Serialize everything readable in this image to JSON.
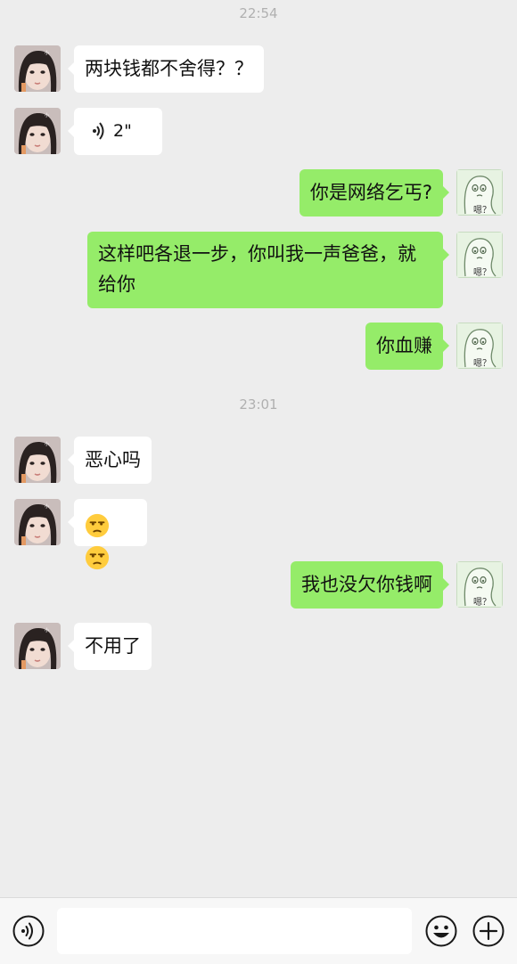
{
  "timestamps": [
    "22:54",
    "23:01"
  ],
  "messages": [
    {
      "side": "in",
      "type": "text",
      "text": "两块钱都不舍得？？"
    },
    {
      "side": "in",
      "type": "voice",
      "duration": "2\""
    },
    {
      "side": "out",
      "type": "text",
      "text": "你是网络乞丐?"
    },
    {
      "side": "out",
      "type": "text",
      "text": "这样吧各退一步，你叫我一声爸爸，就给你"
    },
    {
      "side": "out",
      "type": "text",
      "text": "你血赚"
    },
    {
      "side": "in",
      "type": "text",
      "text": "恶心吗"
    },
    {
      "side": "in",
      "type": "emoji",
      "emoji": [
        "unamused-face",
        "unamused-face"
      ]
    },
    {
      "side": "out",
      "type": "text",
      "text": "我也没欠你钱啊"
    },
    {
      "side": "in",
      "type": "text",
      "text": "不用了"
    }
  ],
  "avatars": {
    "contact": "girl-photo",
    "self": "sticker-ghost",
    "self_caption": "嗯？"
  },
  "input_bar": {
    "voice_icon": "voice-mode-icon",
    "emoji_icon": "smiley-icon",
    "plus_icon": "plus-icon",
    "value": ""
  },
  "colors": {
    "background": "#ededed",
    "incoming_bubble": "#ffffff",
    "outgoing_bubble": "#95ec69",
    "timestamp": "#b0b0b0"
  }
}
